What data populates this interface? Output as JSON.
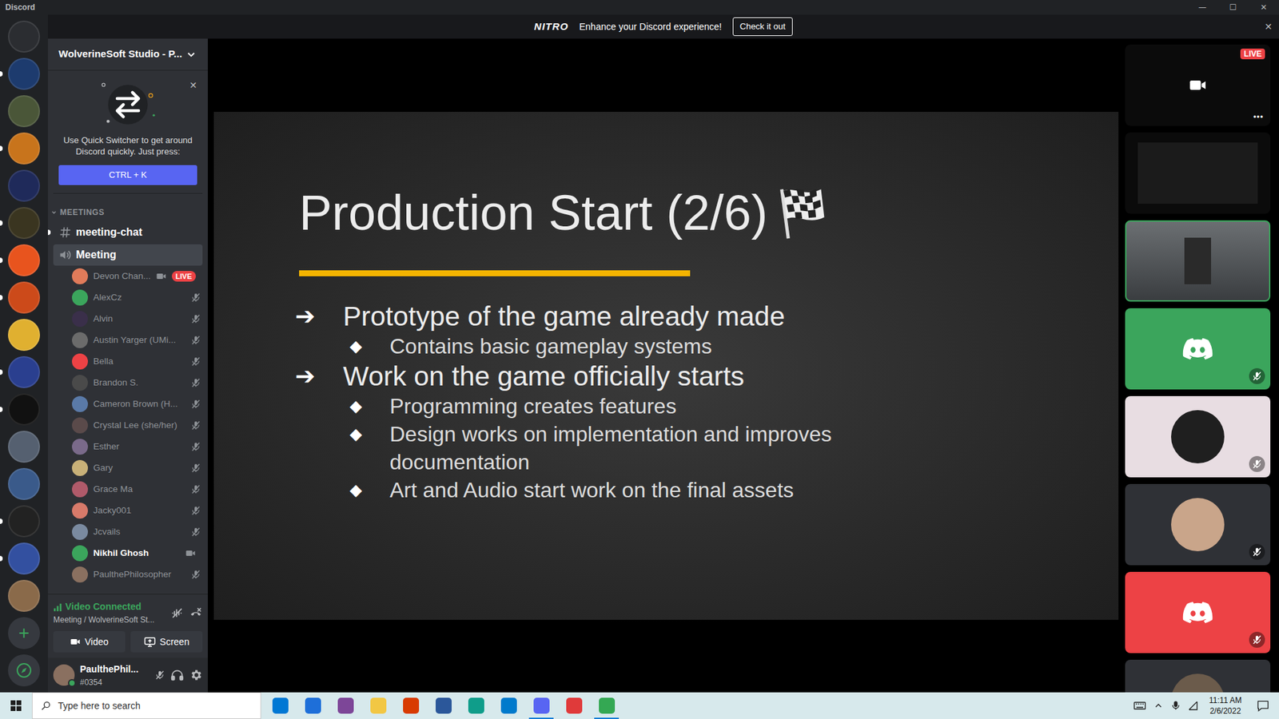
{
  "window": {
    "title": "Discord",
    "controls": [
      "—",
      "☐",
      "✕"
    ]
  },
  "banner": {
    "logo": "NITRO",
    "text": "Enhance your Discord experience!",
    "button": "Check it out",
    "close": "✕"
  },
  "servers": [
    {
      "color": "#2b2d31",
      "unread": false
    },
    {
      "color": "#1d3b6e",
      "unread": true
    },
    {
      "color": "#4a5638",
      "unread": false
    },
    {
      "color": "#c8741c",
      "unread": true
    },
    {
      "color": "#1f2a5a",
      "unread": false
    },
    {
      "color": "#3a3520",
      "unread": true
    },
    {
      "color": "#e8541e",
      "unread": true
    },
    {
      "color": "#cc4a1a",
      "unread": true
    },
    {
      "color": "#e0b030",
      "unread": false
    },
    {
      "color": "#2a3f8f",
      "unread": true
    },
    {
      "color": "#111111",
      "unread": true
    },
    {
      "color": "#556070",
      "unread": false
    },
    {
      "color": "#3a5a8a",
      "unread": false
    },
    {
      "color": "#222222",
      "unread": true
    },
    {
      "color": "#3350a0",
      "unread": true
    },
    {
      "color": "#8a6a4a",
      "unread": false
    }
  ],
  "server_add": "+",
  "server": {
    "name": "WolverineSoft Studio - P..."
  },
  "quick_switcher": {
    "text": "Use Quick Switcher to get around Discord quickly. Just press:",
    "shortcut": "CTRL + K",
    "close": "✕"
  },
  "category": {
    "name": "MEETINGS",
    "expanded": true
  },
  "channels": [
    {
      "name": "meeting-chat",
      "kind": "text",
      "selected": false,
      "unread": true
    },
    {
      "name": "Meeting",
      "kind": "voice",
      "selected": true,
      "unread": false
    }
  ],
  "voice_users": [
    {
      "name": "Devon Chan...",
      "color": "#e07b5a",
      "muted": false,
      "video": true,
      "badge": "LIVE",
      "active": false
    },
    {
      "name": "AlexCz",
      "color": "#3ba55c",
      "muted": true,
      "video": false,
      "active": false
    },
    {
      "name": "Alvin",
      "color": "#3a2f4a",
      "muted": true,
      "video": false,
      "active": false
    },
    {
      "name": "Austin Yarger (UMi...",
      "color": "#6b6b6b",
      "muted": true,
      "video": false,
      "active": false
    },
    {
      "name": "Bella",
      "color": "#ed4245",
      "muted": true,
      "video": false,
      "active": false
    },
    {
      "name": "Brandon S.",
      "color": "#4a4a4a",
      "muted": true,
      "video": false,
      "active": false
    },
    {
      "name": "Cameron Brown (H...",
      "color": "#5a7aa8",
      "muted": true,
      "video": false,
      "active": false
    },
    {
      "name": "Crystal Lee (she/her)",
      "color": "#5a4a4a",
      "muted": true,
      "video": false,
      "active": false
    },
    {
      "name": "Esther",
      "color": "#7a6a8a",
      "muted": true,
      "video": false,
      "active": false
    },
    {
      "name": "Gary",
      "color": "#c8b078",
      "muted": true,
      "video": false,
      "active": false
    },
    {
      "name": "Grace Ma",
      "color": "#b05a6a",
      "muted": true,
      "video": false,
      "active": false
    },
    {
      "name": "Jacky001",
      "color": "#d87a6a",
      "muted": true,
      "video": false,
      "active": false
    },
    {
      "name": "Jcvails",
      "color": "#7a8aa0",
      "muted": true,
      "video": false,
      "active": false
    },
    {
      "name": "Nikhil Ghosh",
      "color": "#3ba55c",
      "muted": false,
      "video": true,
      "active": true
    },
    {
      "name": "PaulthePhilosopher",
      "color": "#8a7060",
      "muted": true,
      "video": false,
      "active": false
    }
  ],
  "voice_panel": {
    "status": "Video Connected",
    "location": "Meeting / WolverineSoft St...",
    "buttons": [
      "Video",
      "Screen"
    ]
  },
  "user_panel": {
    "name": "PaulthePhil...",
    "tag": "#0354",
    "muted": true,
    "status": "online"
  },
  "slide": {
    "title": "Production Start (2/6)",
    "items": [
      {
        "kind": "main",
        "bullet": "➔",
        "text": "Prototype of the game already made"
      },
      {
        "kind": "sub",
        "bullet": "◆",
        "text": "Contains basic gameplay systems"
      },
      {
        "kind": "main",
        "bullet": "➔",
        "text": "Work on the game officially starts"
      },
      {
        "kind": "sub",
        "bullet": "◆",
        "text": "Programming creates features"
      },
      {
        "kind": "sub",
        "bullet": "◆",
        "text": "Design works on implementation and improves documentation"
      },
      {
        "kind": "sub",
        "bullet": "◆",
        "text": "Art and Audio start work on the final assets"
      }
    ]
  },
  "tiles": [
    {
      "kind": "stream",
      "badge": "LIVE",
      "menu": "•••",
      "muted": false
    },
    {
      "kind": "stream",
      "muted": false
    },
    {
      "kind": "video",
      "speaking": true,
      "muted": false
    },
    {
      "kind": "logo",
      "color": "#3ba55c",
      "muted": true
    },
    {
      "kind": "avatar",
      "color": "#e8dde2",
      "avatar": "#1f1f1f",
      "muted": true
    },
    {
      "kind": "avatar",
      "color": "#2f3136",
      "avatar": "#c9a58a",
      "muted": true
    },
    {
      "kind": "logo",
      "color": "#ed4245",
      "muted": true
    },
    {
      "kind": "avatar",
      "color": "#2f3136",
      "avatar": "#6b5b4b",
      "muted": false
    }
  ],
  "taskbar": {
    "search": "Type here to search",
    "apps": [
      {
        "color": "#0078d4",
        "active": false
      },
      {
        "color": "#1e6fd9",
        "active": false
      },
      {
        "color": "#7d4698",
        "active": false
      },
      {
        "color": "#f2c744",
        "active": false
      },
      {
        "color": "#d83b01",
        "active": false
      },
      {
        "color": "#2b579a",
        "active": false
      },
      {
        "color": "#0f9d8a",
        "active": false
      },
      {
        "color": "#007acc",
        "active": false
      },
      {
        "color": "#5865f2",
        "active": true
      },
      {
        "color": "#e03a3a",
        "active": false
      },
      {
        "color": "#34a853",
        "active": true
      }
    ],
    "time": "11:11 AM",
    "date": "2/6/2022"
  }
}
